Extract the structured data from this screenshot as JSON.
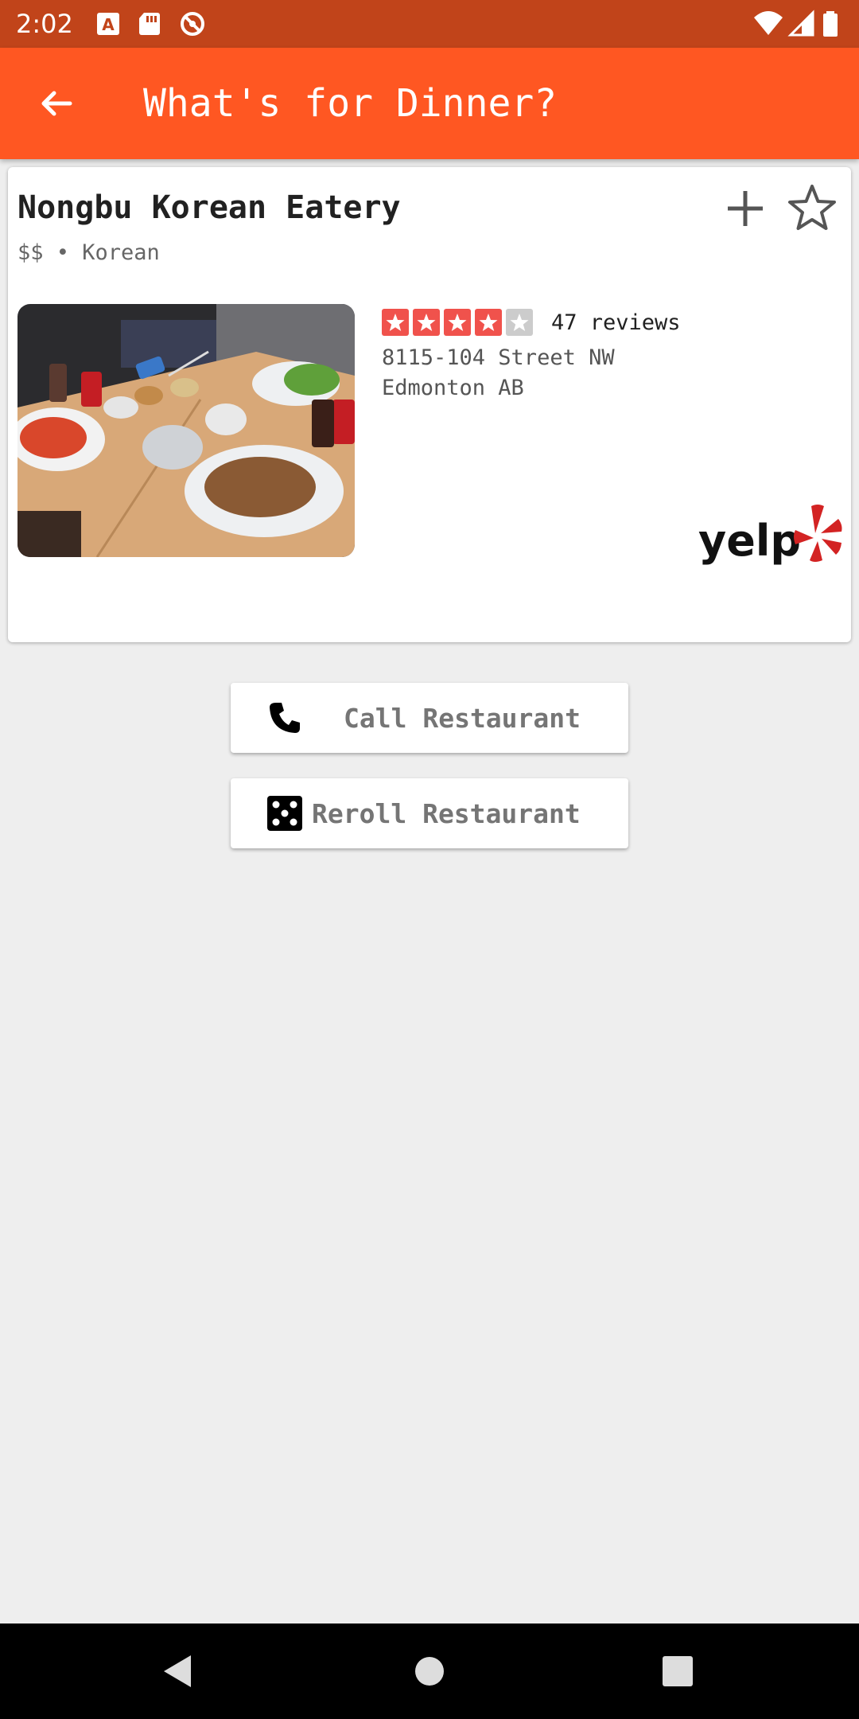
{
  "status_bar": {
    "time": "2:02",
    "icons": [
      "a-notification-icon",
      "sd-card-icon",
      "sync-icon",
      "wifi-icon",
      "signal-icon",
      "battery-icon"
    ]
  },
  "toolbar": {
    "title": "What's for Dinner?",
    "back_icon": "arrow-back-icon",
    "color": "#ff5722"
  },
  "restaurant": {
    "name": "Nongbu Korean Eatery",
    "meta": "$$ • Korean",
    "rating": 4,
    "rating_max": 5,
    "reviews": "47 reviews",
    "address_line1": "8115-104 Street NW",
    "address_line2": "Edmonton AB",
    "source_logo": "yelp",
    "photo": "food-photo"
  },
  "actions": {
    "call_label": "Call Restaurant",
    "reroll_label": "Reroll Restaurant"
  },
  "colors": {
    "status_bar": "#c1441a",
    "accent": "#ff5722",
    "star_on": "#f0524c",
    "yelp_red": "#d32323"
  }
}
